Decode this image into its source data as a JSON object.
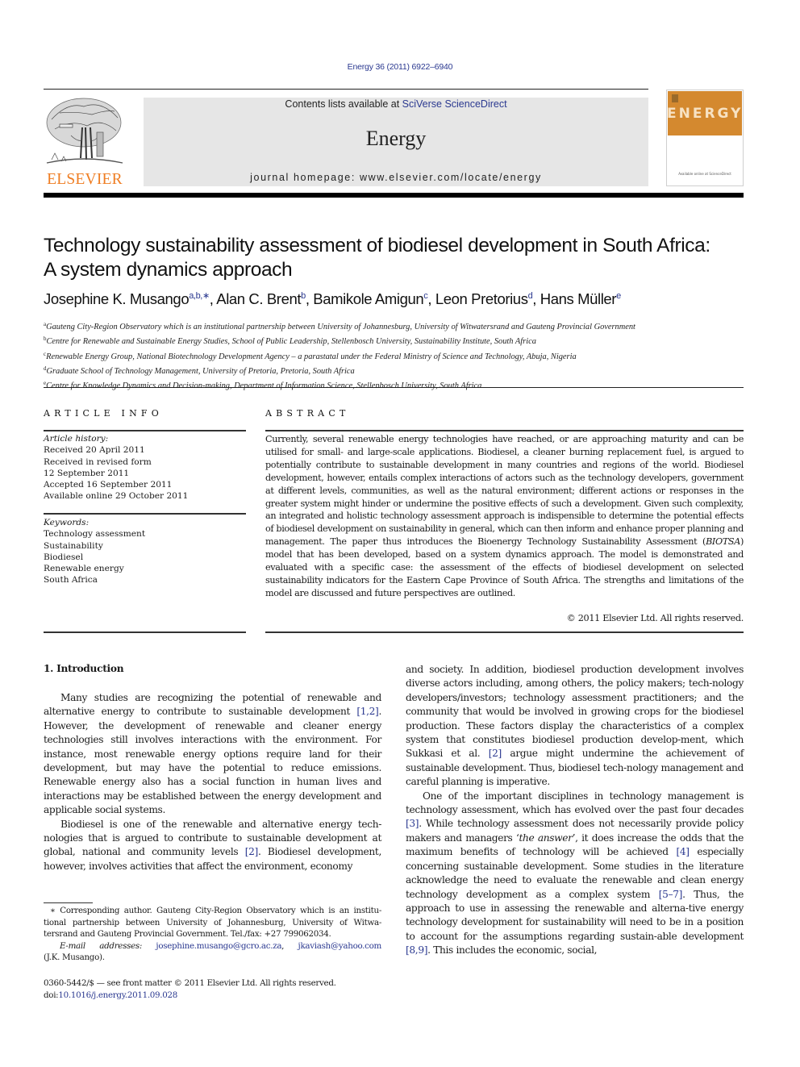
{
  "citation": "Energy 36 (2011) 6922–6940",
  "header": {
    "publisher_logo_text": "ELSEVIER",
    "contents_prefix": "Contents lists available at ",
    "contents_link": "SciVerse ScienceDirect",
    "journal_name": "Energy",
    "homepage_prefix": "journal homepage: ",
    "homepage_url": "www.elsevier.com/locate/energy",
    "cover_title": "ENERGY",
    "cover_footer": "Available online at ScienceDirect",
    "colors": {
      "logo_orange": "#ef7d22",
      "banner_gray": "#e6e6e6",
      "cover_orange": "#d4892f",
      "link_blue": "#2b3990"
    }
  },
  "article": {
    "title_line1": "Technology sustainability assessment of biodiesel development in South Africa:",
    "title_line2": "A system dynamics approach",
    "authors": [
      {
        "name": "Josephine K. Musango",
        "sup": "a,b,∗",
        "sep": ", "
      },
      {
        "name": "Alan C. Brent",
        "sup": "b",
        "sep": ", "
      },
      {
        "name": "Bamikole Amigun",
        "sup": "c",
        "sep": ", "
      },
      {
        "name": "Leon Pretorius",
        "sup": "d",
        "sep": ", "
      },
      {
        "name": "Hans Müller",
        "sup": "e",
        "sep": ""
      }
    ],
    "affiliations": [
      {
        "key": "a",
        "text": "Gauteng City-Region Observatory which is an institutional partnership between University of Johannesburg, University of Witwatersrand and Gauteng Provincial Government"
      },
      {
        "key": "b",
        "text": "Centre for Renewable and Sustainable Energy Studies, School of Public Leadership, Stellenbosch University, Sustainability Institute, South Africa"
      },
      {
        "key": "c",
        "text": "Renewable Energy Group, National Biotechnology Development Agency – a parastatal under the Federal Ministry of Science and Technology, Abuja, Nigeria"
      },
      {
        "key": "d",
        "text": "Graduate School of Technology Management, University of Pretoria, Pretoria, South Africa"
      },
      {
        "key": "e",
        "text": "Centre for Knowledge Dynamics and Decision-making, Department of Information Science, Stellenbosch University, South Africa"
      }
    ]
  },
  "article_info": {
    "heading": "ARTICLE INFO",
    "history_label": "Article history:",
    "history": [
      "Received 20 April 2011",
      "Received in revised form",
      "12 September 2011",
      "Accepted 16 September 2011",
      "Available online 29 October 2011"
    ],
    "keywords_label": "Keywords:",
    "keywords": [
      "Technology assessment",
      "Sustainability",
      "Biodiesel",
      "Renewable energy",
      "South Africa"
    ]
  },
  "abstract": {
    "heading": "ABSTRACT",
    "text_before_italic": "Currently, several renewable energy technologies have reached, or are approaching maturity and can be utilised for small- and large-scale applications. Biodiesel, a cleaner burning replacement fuel, is argued to potentially contribute to sustainable development in many countries and regions of the world. Biodiesel development, however, entails complex interactions of actors such as the technology developers, government at different levels, communities, as well as the natural environment; different actions or responses in the greater system might hinder or undermine the positive effects of such a development. Given such complexity, an integrated and holistic technology assessment approach is indispensible to determine the potential effects of biodiesel development on sustainability in general, which can then inform and enhance proper planning and management. The paper thus introduces the Bioenergy Technology Sustainability Assessment (",
    "italic": "BIOTSA",
    "text_after_italic": ") model that has been developed, based on a system dynamics approach. The model is demonstrated and evaluated with a specific case: the assessment of the effects of biodiesel development on selected sustainability indicators for the Eastern Cape Province of South Africa. The strengths and limitations of the model are discussed and future perspectives are outlined.",
    "copyright": "© 2011 Elsevier Ltd. All rights reserved."
  },
  "introduction": {
    "heading": "1.  Introduction",
    "p1": {
      "a": "Many studies are recognizing the potential of renewable and alternative energy to contribute to sustainable development ",
      "ref1": "[1,2]",
      "b": ". However, the development of renewable and cleaner energy technologies still involves interactions with the environment. For instance, most renewable energy options require land for their development, but may have the potential to reduce emissions. Renewable energy also has a social function in human lives and interactions may be established between the energy development and applicable social systems."
    },
    "p2": {
      "a": "Biodiesel is one of the renewable and alternative energy tech-nologies that is argued to contribute to sustainable development at global, national and community levels ",
      "ref1": "[2]",
      "b": ". Biodiesel development, however, involves activities that affect the environment, economy"
    },
    "p2_cont": {
      "a": "and society. In addition, biodiesel production development involves diverse actors including, among others, the policy makers; tech-nology developers/investors; technology assessment practitioners; and the community that would be involved in growing crops for the biodiesel production. These factors display the characteristics of a complex system that constitutes biodiesel production develop-ment, which Sukkasi et al. ",
      "ref1": "[2]",
      "b": " argue might undermine the achievement of sustainable development. Thus, biodiesel tech-nology management and careful planning is imperative."
    },
    "p3": {
      "a": "One of the important disciplines in technology management is technology assessment, which has evolved over the past four decades ",
      "ref1": "[3]",
      "b": ". While technology assessment does not necessarily provide policy makers and managers ‘",
      "italic": "the answer",
      "c": "’, it does increase the odds that the maximum benefits of technology will be achieved ",
      "ref2": "[4]",
      "d": " especially concerning sustainable development. Some studies in the literature acknowledge the need to evaluate the renewable and clean energy technology development as a complex system ",
      "ref3": "[5–7]",
      "e": ". Thus, the approach to use in assessing the renewable and alterna-tive energy technology development for sustainability will need to be in a position to account for the assumptions regarding sustain-able development ",
      "ref4": "[8,9]",
      "f": ". This includes the economic, social,"
    }
  },
  "footnote": {
    "corresponding": "∗ Corresponding author. Gauteng City-Region Observatory which is an institu-tional partnership between University of Johannesburg, University of Witwa-tersrand and Gauteng Provincial Government. Tel./fax: +27 799062034.",
    "email_label": "E-mail addresses:",
    "email1": "josephine.musango@gcro.ac.za",
    "email2": "jkaviash@yahoo.com",
    "email_owner": "(J.K. Musango)."
  },
  "front_matter": {
    "issn_line": "0360-5442/$ — see front matter © 2011 Elsevier Ltd. All rights reserved.",
    "doi_prefix": "doi:",
    "doi": "10.1016/j.energy.2011.09.028"
  }
}
